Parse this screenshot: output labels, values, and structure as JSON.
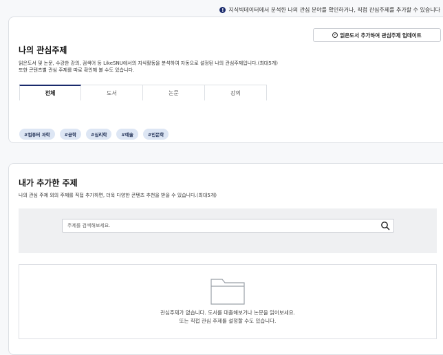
{
  "notice": {
    "icon": "info-icon",
    "icon_glyph": "!",
    "text": "지식빅데이터에서 분석한 나의 관심 분야를 확인하거나, 직접 관심주제를 추가할 수 있습니다"
  },
  "interests": {
    "update_button": "읽은도서 추가하여 관심주제 업데이트",
    "title": "나의 관심주제",
    "desc_line1": "읽은도서 및 논문, 수강한 강의, 검색어 등 LikeSNU에서의 지식활동을 분석하여 자동으로 설정된 나의 관심주제입니다.(최대5개)",
    "desc_line2": "또한 콘텐츠별 관심 주제를 따로 확인해 볼 수도 있습니다.",
    "tabs": [
      {
        "label": "전체"
      },
      {
        "label": "도서"
      },
      {
        "label": "논문"
      },
      {
        "label": "강의"
      }
    ],
    "tags": [
      "#컴퓨터 과학",
      "#공학",
      "#심리학",
      "#예술",
      "#인문학"
    ]
  },
  "added": {
    "title": "내가 추가한 주제",
    "desc": "나의 관심 주제 외의 주제를 직접 추가하면, 더욱 다양한 콘텐츠 추천을 받을 수 있습니다.(최대5개)",
    "search_placeholder": "주제를 검색해보세요.",
    "search_value": "",
    "empty_line1": "관심주제가 없습니다. 도서를 대출해보거나 논문을 읽어보세요.",
    "empty_line2": "또는 직접 관심 주제를 설정할 수도 있습니다."
  },
  "colors": {
    "accent": "#1a2a6c",
    "tag_bg": "#dde6f4",
    "search_bg": "#eff0f2"
  }
}
